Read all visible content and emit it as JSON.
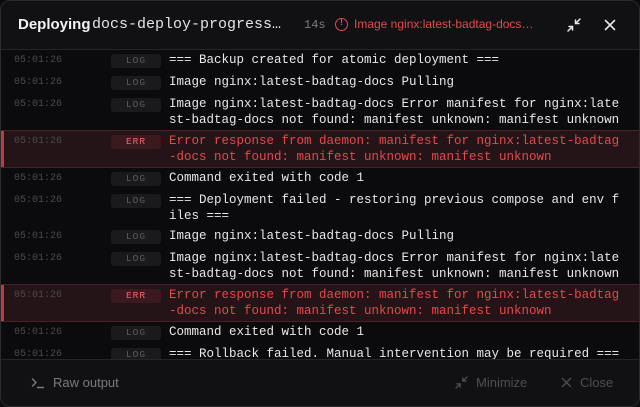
{
  "header": {
    "title": "Deploying",
    "deployment_name": "docs-deploy-progress-d…",
    "elapsed": "14s",
    "error_summary": "Image nginx:latest-badtag-docs P…"
  },
  "log": {
    "rows": [
      {
        "time": "05:01:26",
        "level": "LOG",
        "message": "=== Backup created for atomic deployment ===",
        "is_error": false
      },
      {
        "time": "05:01:26",
        "level": "LOG",
        "message": "Image nginx:latest-badtag-docs Pulling",
        "is_error": false
      },
      {
        "time": "05:01:26",
        "level": "LOG",
        "message": "Image nginx:latest-badtag-docs Error manifest for nginx:latest-badtag-docs not found: manifest unknown: manifest unknown",
        "is_error": false
      },
      {
        "time": "05:01:26",
        "level": "ERR",
        "message": "Error response from daemon: manifest for nginx:latest-badtag-docs not found: manifest unknown: manifest unknown",
        "is_error": true
      },
      {
        "time": "05:01:26",
        "level": "LOG",
        "message": "Command exited with code 1",
        "is_error": false
      },
      {
        "time": "05:01:26",
        "level": "LOG",
        "message": "=== Deployment failed - restoring previous compose and env files ===",
        "is_error": false
      },
      {
        "time": "05:01:26",
        "level": "LOG",
        "message": "Image nginx:latest-badtag-docs Pulling",
        "is_error": false
      },
      {
        "time": "05:01:26",
        "level": "LOG",
        "message": "Image nginx:latest-badtag-docs Error manifest for nginx:latest-badtag-docs not found: manifest unknown: manifest unknown",
        "is_error": false
      },
      {
        "time": "05:01:26",
        "level": "ERR",
        "message": "Error response from daemon: manifest for nginx:latest-badtag-docs not found: manifest unknown: manifest unknown",
        "is_error": true
      },
      {
        "time": "05:01:26",
        "level": "LOG",
        "message": "Command exited with code 1",
        "is_error": false
      },
      {
        "time": "05:01:26",
        "level": "LOG",
        "message": "=== Rollback failed. Manual intervention may be required ===",
        "is_error": false
      }
    ]
  },
  "footer": {
    "raw_output_label": "Raw output",
    "minimize_label": "Minimize",
    "close_label": "Close"
  },
  "colors": {
    "error": "#e5484d",
    "background": "#0e0e10"
  },
  "icons": {
    "error": "alert-circle-icon",
    "minimize": "minimize-arrows-icon",
    "close": "close-icon",
    "terminal": "terminal-icon"
  }
}
